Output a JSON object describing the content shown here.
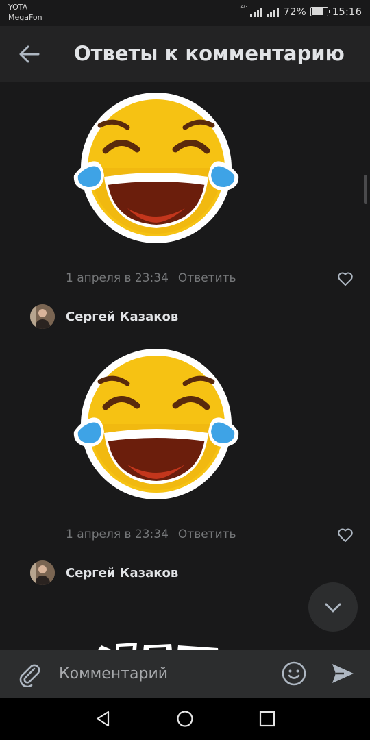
{
  "status_bar": {
    "carrier_1": "YOTA",
    "carrier_2": "MegaFon",
    "network": "4G",
    "battery": "72%",
    "time": "15:16"
  },
  "header": {
    "title": "Ответы к комментарию",
    "back_icon": "arrow-left-icon"
  },
  "comments": [
    {
      "type": "sticker",
      "sticker": "laughing-tears-emoji",
      "date": "1 апреля в 23:34",
      "reply_label": "Ответить",
      "like_icon": "heart-outline-icon"
    },
    {
      "author": "Сергей Казаков",
      "type": "sticker",
      "sticker": "laughing-tears-emoji",
      "date": "1 апреля в 23:34",
      "reply_label": "Ответить",
      "like_icon": "heart-outline-icon"
    },
    {
      "author": "Сергей Казаков",
      "type": "sticker-partial"
    }
  ],
  "composer": {
    "placeholder": "Комментарий",
    "attach_icon": "paperclip-icon",
    "emoji_icon": "smile-icon",
    "send_icon": "send-icon"
  },
  "fab_icon": "chevron-down-icon",
  "nav_icons": [
    "back-triangle-icon",
    "home-circle-icon",
    "recents-square-icon"
  ],
  "colors": {
    "background": "#19191a",
    "header": "#232324",
    "composer": "#2c2d2e",
    "secondary_text": "#76787a",
    "primary_text": "#e1e3e6"
  }
}
